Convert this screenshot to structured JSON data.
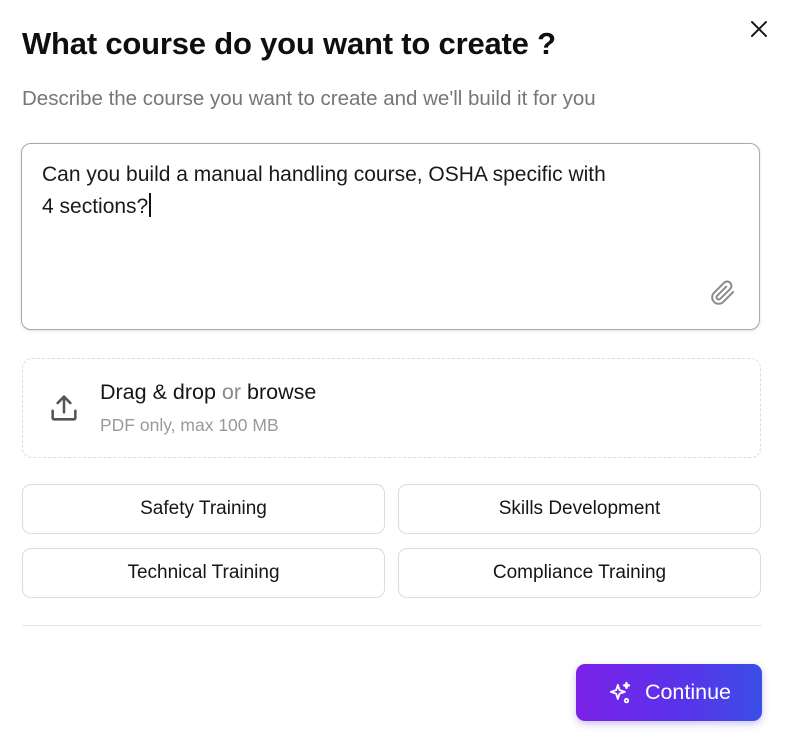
{
  "dialog": {
    "title": "What course do you want to create ?",
    "subtitle": "Describe the course you want to create and we'll build it for you",
    "close_icon": "close-icon"
  },
  "prompt": {
    "value": "Can you build a manual handling course, OSHA specific with\n4 sections?",
    "attach_icon": "paperclip-icon"
  },
  "upload": {
    "icon": "upload-icon",
    "drag_label": "Drag & drop",
    "or_label": "or",
    "browse_label": "browse",
    "hint": "PDF only, max 100 MB"
  },
  "suggestions": [
    {
      "label": "Safety Training"
    },
    {
      "label": "Skills Development"
    },
    {
      "label": "Technical Training"
    },
    {
      "label": "Compliance Training"
    }
  ],
  "footer": {
    "continue_label": "Continue",
    "continue_icon": "sparkles-icon"
  },
  "colors": {
    "accent_start": "#7b21e8",
    "accent_end": "#3b4fe6",
    "subtitle": "#7a7570",
    "border": "#dcdcdc"
  }
}
